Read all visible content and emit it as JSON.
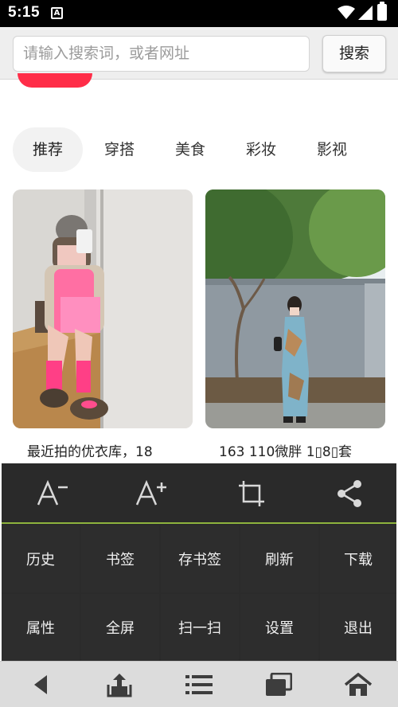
{
  "status_bar": {
    "time": "5:15",
    "notification_icon": "A"
  },
  "search": {
    "placeholder": "请输入搜索词，或者网址",
    "button_label": "搜索"
  },
  "tabs": [
    {
      "label": "推荐",
      "active": true
    },
    {
      "label": "穿搭",
      "active": false
    },
    {
      "label": "美食",
      "active": false
    },
    {
      "label": "彩妆",
      "active": false
    },
    {
      "label": "影视",
      "active": false
    }
  ],
  "cards": [
    {
      "title": "最近拍的优衣库，18"
    },
    {
      "title": "163 110微胖 1▯8▯套"
    }
  ],
  "toolbar": {
    "icons": [
      "font-decrease-icon",
      "font-increase-icon",
      "crop-icon",
      "share-icon"
    ]
  },
  "menu": {
    "items": [
      {
        "label": "历史"
      },
      {
        "label": "书签"
      },
      {
        "label": "存书签"
      },
      {
        "label": "刷新"
      },
      {
        "label": "下载"
      },
      {
        "label": "属性"
      },
      {
        "label": "全屏"
      },
      {
        "label": "扫一扫"
      },
      {
        "label": "设置"
      },
      {
        "label": "退出"
      }
    ]
  },
  "nav_bar": {
    "icons": [
      "back-icon",
      "share-tray-icon",
      "menu-list-icon",
      "windows-icon",
      "home-icon"
    ]
  },
  "colors": {
    "accent": "#ff2d48",
    "menu_bg": "#2b2b2b",
    "menu_divider": "#8db33d"
  }
}
